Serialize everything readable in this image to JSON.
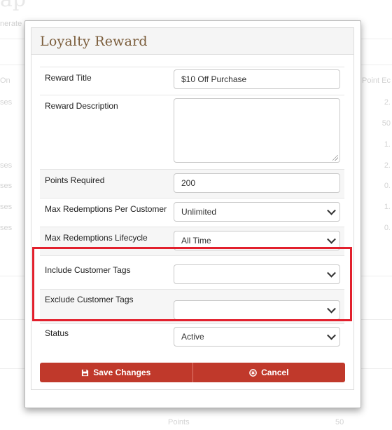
{
  "background": {
    "title_fragment": "ap",
    "subtitle_fragment": "nerate",
    "header_left": "On",
    "header_right": "Point Ec",
    "rows_left": [
      "ses",
      "",
      "",
      "ses",
      "ses",
      "ses",
      "ses"
    ],
    "rows_right": [
      "2.",
      "50",
      "1.",
      "2.",
      "0.",
      "1.",
      "0."
    ],
    "footer_points": "Points",
    "footer_value": "50"
  },
  "modal": {
    "title": "Loyalty Reward",
    "fields": {
      "reward_title": {
        "label": "Reward Title",
        "value": "$10 Off Purchase"
      },
      "reward_description": {
        "label": "Reward Description",
        "value": ""
      },
      "points_required": {
        "label": "Points Required",
        "value": "200"
      },
      "max_per_customer": {
        "label": "Max Redemptions Per Customer",
        "value": "Unlimited"
      },
      "max_lifecycle": {
        "label": "Max Redemptions Lifecycle",
        "value": "All Time"
      },
      "include_tags": {
        "label": "Include Customer Tags",
        "value": ""
      },
      "exclude_tags": {
        "label": "Exclude Customer Tags",
        "value": ""
      },
      "status": {
        "label": "Status",
        "value": "Active"
      }
    },
    "buttons": {
      "save": "Save Changes",
      "cancel": "Cancel"
    }
  },
  "colors": {
    "title": "#7a5c3a",
    "button": "#c0392b",
    "highlight": "#e2202d"
  },
  "icons": {
    "save": "floppy-disk-icon",
    "cancel": "circle-x-icon",
    "dropdown": "chevron-down-icon"
  }
}
